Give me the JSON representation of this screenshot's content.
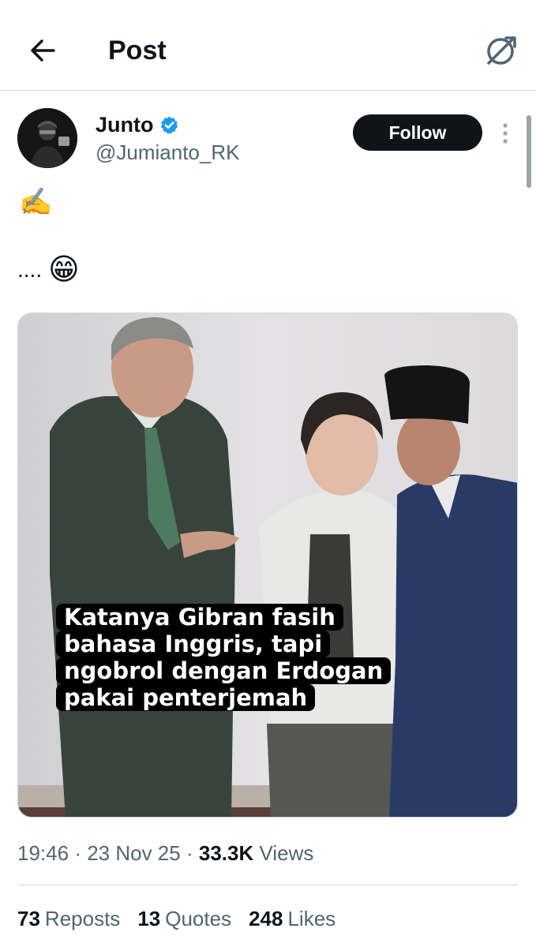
{
  "header": {
    "title": "Post",
    "icons": {
      "back": "arrow-left-icon",
      "right": "sync-slash-icon"
    }
  },
  "author": {
    "name": "Junto",
    "handle": "@Jumianto_RK",
    "follow_label": "Follow",
    "verified": true,
    "verified_color": "#1d9bf0"
  },
  "post": {
    "line1": "✍️",
    "dots": "....",
    "emoji": "😁"
  },
  "media": {
    "caption_lines": [
      "Katanya Gibran fasih",
      "bahasa Inggris, tapi",
      "ngobrol dengan Erdogan",
      "pakai penterjemah"
    ]
  },
  "meta": {
    "time": "19:46",
    "date": "23 Nov 25",
    "views_count": "33.3K",
    "views_label": "Views"
  },
  "stats": {
    "reposts_count": "73",
    "reposts_label": "Reposts",
    "quotes_count": "13",
    "quotes_label": "Quotes",
    "likes_count": "248",
    "likes_label": "Likes"
  },
  "colors": {
    "text": "#0f1419",
    "secondary": "#536471",
    "border": "#cfd9de",
    "follow_bg": "#0f1419"
  }
}
